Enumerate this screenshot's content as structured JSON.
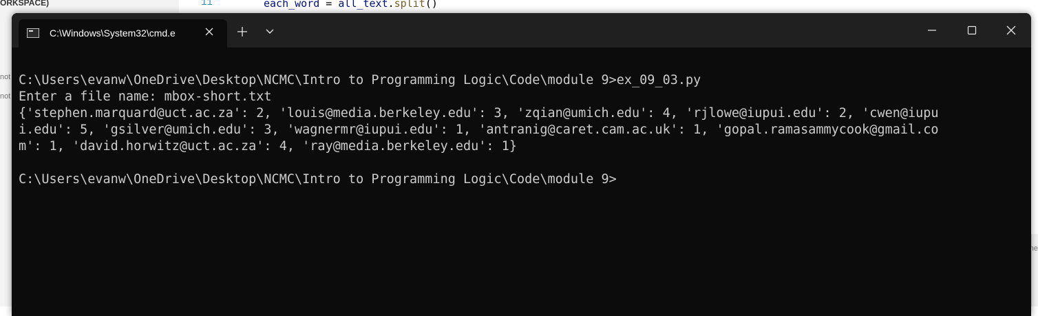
{
  "background_editor": {
    "sidebar_header": "ORKSPACE)",
    "sidebar_fragments": [
      "not",
      "not"
    ],
    "line_number": "11",
    "code_var": "each_word",
    "code_op": " = ",
    "code_obj": "all_text",
    "code_dot": ".",
    "code_fn": "split",
    "code_parens": "()",
    "right_fragment": "ne"
  },
  "terminal": {
    "tab": {
      "title": "C:\\Windows\\System32\\cmd.e",
      "icon": "cmd-prompt-icon",
      "close_icon": "close-icon"
    },
    "new_tab_label": "+",
    "dropdown_icon": "chevron-down-icon",
    "window_controls": {
      "minimize_icon": "minimize-icon",
      "maximize_icon": "maximize-icon",
      "close_icon": "close-icon"
    },
    "lines": [
      "C:\\Users\\evanw\\OneDrive\\Desktop\\NCMC\\Intro to Programming Logic\\Code\\module 9>ex_09_03.py",
      "Enter a file name: mbox-short.txt",
      "{'stephen.marquard@uct.ac.za': 2, 'louis@media.berkeley.edu': 3, 'zqian@umich.edu': 4, 'rjlowe@iupui.edu': 2, 'cwen@iupu",
      "i.edu': 5, 'gsilver@umich.edu': 3, 'wagnermr@iupui.edu': 1, 'antranig@caret.cam.ac.uk': 1, 'gopal.ramasammycook@gmail.co",
      "m': 1, 'david.horwitz@uct.ac.za': 4, 'ray@media.berkeley.edu': 1}",
      "",
      "C:\\Users\\evanw\\OneDrive\\Desktop\\NCMC\\Intro to Programming Logic\\Code\\module 9>"
    ]
  },
  "colors": {
    "terminal_bg": "#0c0c0c",
    "title_bar_bg": "#202020",
    "terminal_text": "#cccccc"
  }
}
